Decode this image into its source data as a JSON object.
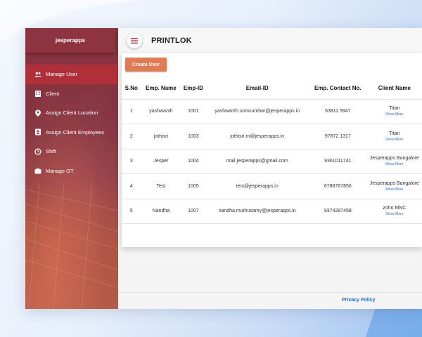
{
  "sidebar": {
    "brand": "jesperapps",
    "items": [
      {
        "label": "Manage User",
        "icon": "users-icon",
        "active": true
      },
      {
        "label": "Client",
        "icon": "building-icon",
        "active": false
      },
      {
        "label": "Assign Client Location",
        "icon": "location-icon",
        "active": false
      },
      {
        "label": "Assign Client Employees",
        "icon": "id-card-icon",
        "active": false
      },
      {
        "label": "Shift",
        "icon": "clock-icon",
        "active": false
      },
      {
        "label": "Manage OT",
        "icon": "briefcase-icon",
        "active": false
      }
    ]
  },
  "header": {
    "title": "PRINTLOK",
    "menu_icon": "hamburger-icon"
  },
  "toolbar": {
    "create_label": "Create User"
  },
  "table": {
    "columns": [
      "S.No",
      "Emp. Name",
      "Emp-ID",
      "Email-ID",
      "Emp. Contact No.",
      "Client Name"
    ],
    "show_more_label": "Show More",
    "rows": [
      {
        "sno": "1",
        "name": "yashwanth",
        "emp_id": "1001",
        "email": "yashwanth.somsunthar@jesperapps.in",
        "contact": "63811 5947",
        "client": "Titan"
      },
      {
        "sno": "2",
        "name": "jothisri",
        "emp_id": "1003",
        "email": "jothisri.m@jesperapps.in",
        "contact": "97872 1317",
        "client": "Titan"
      },
      {
        "sno": "3",
        "name": "Jesper",
        "emp_id": "1004",
        "email": "mail.jesperapps@gmail.com",
        "contact": "9361011741",
        "client": "Jesperapps Bangalore"
      },
      {
        "sno": "4",
        "name": "Test",
        "emp_id": "1005",
        "email": "test@jesperapps.in",
        "contact": "6788767856",
        "client": "Jesperapps Bangalore"
      },
      {
        "sno": "5",
        "name": "Nandha",
        "emp_id": "1007",
        "email": "nandha.muthusamy@jesperapps.in",
        "contact": "9374287458",
        "client": "zoho MNC"
      }
    ]
  },
  "footer": {
    "privacy_label": "Privacy Policy"
  },
  "colors": {
    "sidebar": "#8d3440",
    "active_item": "#b0303a",
    "accent_button": "#e07b54",
    "link": "#2a6ec8",
    "hamburger": "#d9343f"
  }
}
